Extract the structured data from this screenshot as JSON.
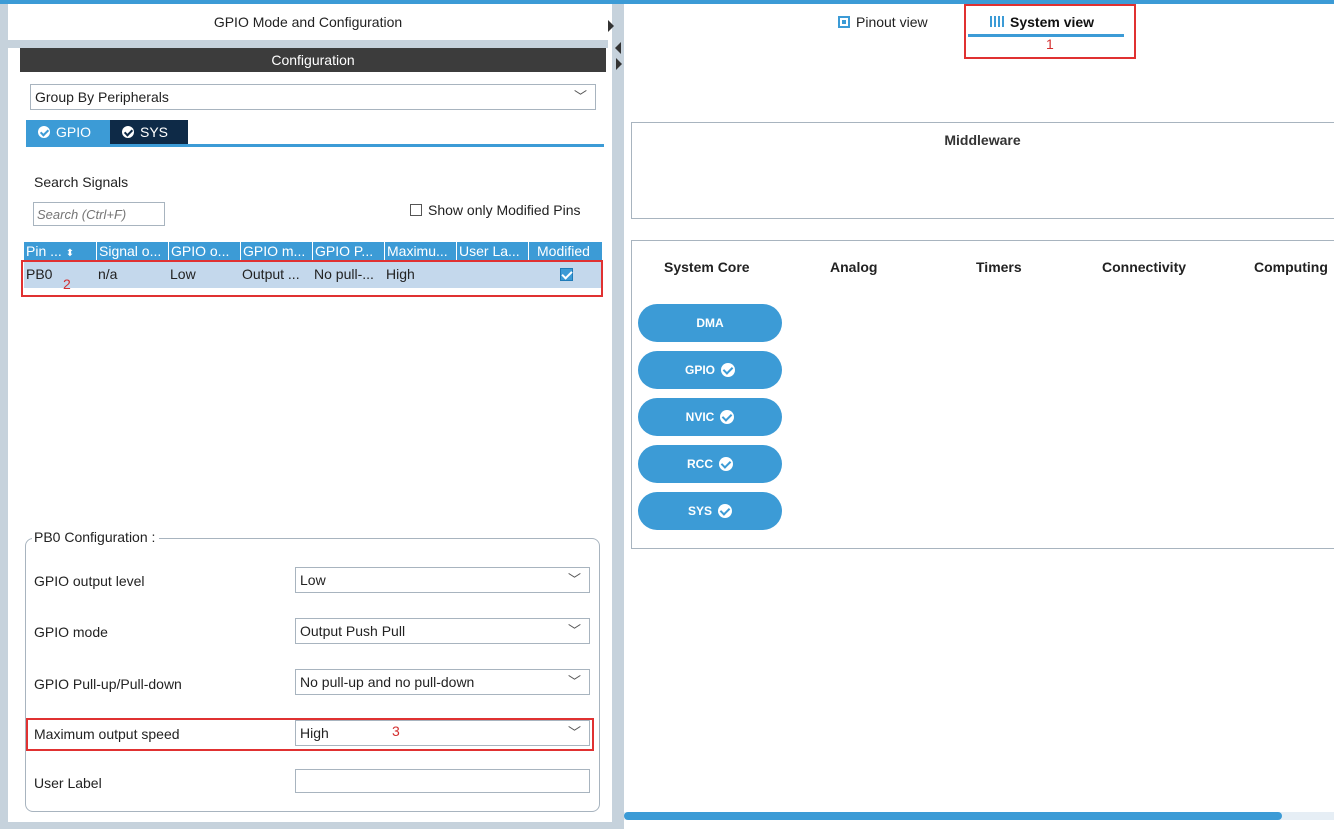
{
  "left_panel": {
    "title": "GPIO Mode and Configuration",
    "config_header": "Configuration",
    "group_by": "Group By Peripherals",
    "tabs": [
      {
        "label": "GPIO",
        "active": true
      },
      {
        "label": "SYS",
        "active": false
      }
    ],
    "search": {
      "label": "Search Signals",
      "placeholder": "Search (Ctrl+F)",
      "show_modified_label": "Show only Modified Pins",
      "show_modified_checked": false
    },
    "table": {
      "headers": [
        "Pin ...",
        "Signal o...",
        "GPIO o...",
        "GPIO m...",
        "GPIO P...",
        "Maximu...",
        "User La...",
        "Modified"
      ],
      "rows": [
        {
          "pin": "PB0",
          "signal": "n/a",
          "gpio_output": "Low",
          "gpio_mode": "Output ...",
          "gpio_pull": "No pull-...",
          "max_speed": "High",
          "user_label": "",
          "modified": true
        }
      ],
      "annotation": "2"
    },
    "pin_config": {
      "legend": "PB0 Configuration :",
      "fields": [
        {
          "label": "GPIO output level",
          "value": "Low"
        },
        {
          "label": "GPIO mode",
          "value": "Output Push Pull"
        },
        {
          "label": "GPIO Pull-up/Pull-down",
          "value": "No pull-up and no pull-down"
        },
        {
          "label": "Maximum output speed",
          "value": "High"
        },
        {
          "label": "User Label",
          "value": ""
        }
      ],
      "annotation": "3"
    }
  },
  "right_panel": {
    "view_tabs": [
      {
        "label": "Pinout view",
        "active": false
      },
      {
        "label": "System view",
        "active": true
      }
    ],
    "view_annotation": "1",
    "middleware_title": "Middleware",
    "categories": [
      "System Core",
      "Analog",
      "Timers",
      "Connectivity",
      "Computing"
    ],
    "system_core_items": [
      {
        "label": "DMA",
        "configured": false
      },
      {
        "label": "GPIO",
        "configured": true
      },
      {
        "label": "NVIC",
        "configured": true
      },
      {
        "label": "RCC",
        "configured": true
      },
      {
        "label": "SYS",
        "configured": true
      }
    ]
  },
  "colors": {
    "accent": "#3c9bd6",
    "dark_tab": "#0e2a47",
    "highlight_box": "#e03131",
    "frame": "#c6d2dc"
  }
}
